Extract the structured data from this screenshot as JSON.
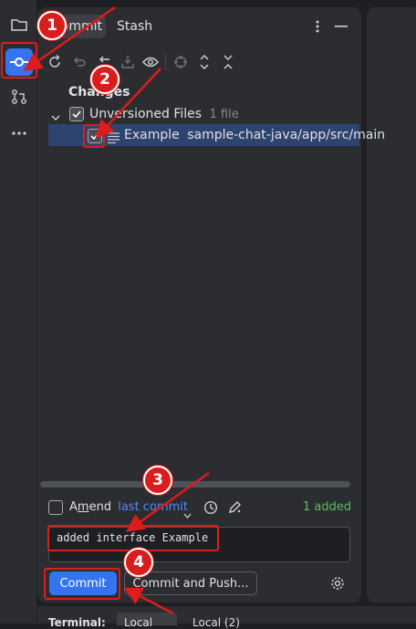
{
  "sidebar": {
    "items": [
      {
        "icon": "folder-icon"
      },
      {
        "icon": "commit-icon",
        "active": true
      },
      {
        "icon": "pull-request-icon"
      },
      {
        "icon": "more-icon"
      }
    ]
  },
  "tabs": [
    {
      "label": "Commit",
      "active": true
    },
    {
      "label": "Stash",
      "active": false
    }
  ],
  "toolbar": {
    "icons": [
      "refresh-icon",
      "undo-icon",
      "rollback-icon",
      "shelve-icon",
      "eye-icon",
      "crosshair-icon",
      "expand-icon",
      "collapse-icon"
    ]
  },
  "tree": {
    "changes_label": "Changes",
    "group_label": "Unversioned Files",
    "group_count": "1 file",
    "file_name": "Example",
    "file_path": "sample-chat-java/app/src/main"
  },
  "commit_options": {
    "amend_label": "Amend",
    "amend_underline_char": "m",
    "last_commit_label": "last commit",
    "status_text": "1 added"
  },
  "message": {
    "value": "added interface Example"
  },
  "buttons": {
    "commit_label": "Commit",
    "commit_and_push_label": "Commit and Push..."
  },
  "bottom": {
    "terminal_label": "Terminal:",
    "local_tab": "Local",
    "local2_tab": "Local (2)"
  },
  "annotations": {
    "steps": [
      "1",
      "2",
      "3",
      "4"
    ],
    "color": "#e01b1b"
  },
  "colors": {
    "accent": "#3574f0",
    "selection": "#2e436e",
    "link": "#548af7",
    "success": "#5fb865"
  }
}
